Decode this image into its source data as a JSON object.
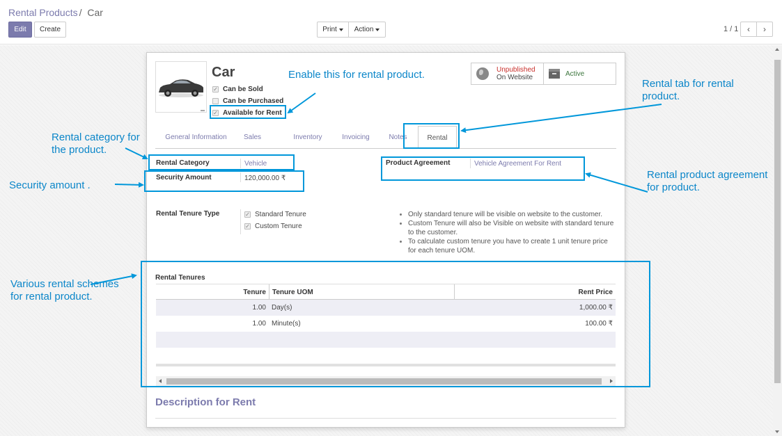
{
  "breadcrumb": {
    "parent": "Rental Products",
    "separator": "/",
    "current": "Car"
  },
  "control_panel": {
    "edit_label": "Edit",
    "create_label": "Create",
    "print_label": "Print",
    "action_label": "Action",
    "pager": "1 / 1"
  },
  "product": {
    "name": "Car",
    "checks": [
      {
        "label": "Can be Sold",
        "checked": true
      },
      {
        "label": "Can be Purchased",
        "checked": false
      },
      {
        "label": "Available for Rent",
        "checked": true
      }
    ]
  },
  "smart_buttons": {
    "website_status": "Unpublished",
    "website_sub": "On Website",
    "active_label": "Active"
  },
  "tabs": [
    "General Information",
    "Sales",
    "Inventory",
    "Invoicing",
    "Notes",
    "Rental"
  ],
  "active_tab": "Rental",
  "rental": {
    "category_label": "Rental Category",
    "category_value": "Vehicle",
    "security_label": "Security Amount",
    "security_value": "120,000.00 ₹",
    "agreement_label": "Product Agreement",
    "agreement_value": "Vehicle Agreement For Rent",
    "tenure_type_label": "Rental Tenure Type",
    "tenure_types": [
      "Standard Tenure",
      "Custom Tenure"
    ],
    "notes": [
      "Only standard tenure will be visible on website to the customer.",
      "Custom Tenure will also be Visible on website with standard tenure to the customer.",
      "To calculate custom tenure you have to create 1 unit tenure price for each tenure UOM."
    ]
  },
  "tenures_table": {
    "title": "Rental Tenures",
    "columns": [
      "Tenure",
      "Tenure UOM",
      "Rent Price"
    ],
    "rows": [
      [
        "1.00",
        "Day(s)",
        "1,000.00 ₹"
      ],
      [
        "1.00",
        "Minute(s)",
        "100.00 ₹"
      ]
    ]
  },
  "description_title": "Description for Rent",
  "annotations": {
    "enable": "Enable this for rental product.",
    "rental_tab": [
      "Rental tab for rental",
      "product."
    ],
    "category": [
      "Rental category for",
      "the product."
    ],
    "security": "Security amount .",
    "agreement": [
      "Rental product agreement",
      "for product."
    ],
    "schemes": [
      "Various rental schemes",
      "for rental product."
    ]
  },
  "colors": {
    "accent": "#7c7bad",
    "annotation": "#0097da",
    "unpublished": "#c9302c",
    "active": "#3c763d"
  }
}
